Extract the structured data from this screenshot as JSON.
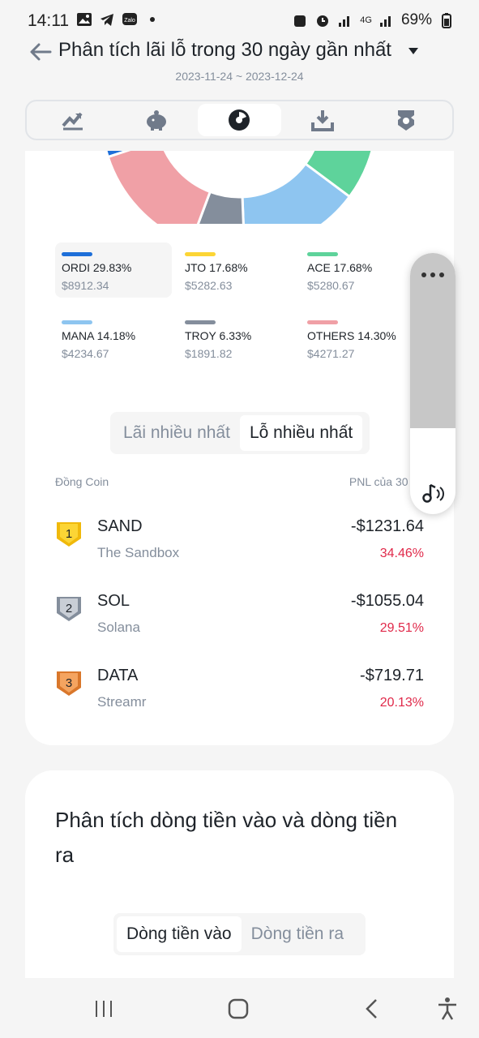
{
  "status_bar": {
    "time": "14:11",
    "battery": "69%",
    "network": "4G"
  },
  "header": {
    "title": "Phân tích lãi lỗ trong 30 ngày gần nhất",
    "date_range": "2023-11-24 ~ 2023-12-24"
  },
  "tabs": [
    {
      "icon": "trend-up-icon",
      "active": false
    },
    {
      "icon": "piggy-bank-icon",
      "active": false
    },
    {
      "icon": "pie-chart-icon",
      "active": true
    },
    {
      "icon": "download-tray-icon",
      "active": false
    },
    {
      "icon": "badge-icon",
      "active": false
    }
  ],
  "chart_data": {
    "type": "pie",
    "categories": [
      "ORDI",
      "JTO",
      "ACE",
      "MANA",
      "TROY",
      "OTHERS"
    ],
    "values": [
      29.83,
      17.68,
      17.68,
      14.18,
      6.33,
      14.3
    ],
    "colors": [
      "#1e6fd9",
      "#fcd535",
      "#5ed39b",
      "#8ec5f0",
      "#848e9c",
      "#f0a0a6"
    ]
  },
  "legend": [
    {
      "label": "ORDI 29.83%",
      "value": "$8912.34",
      "color": "#1e6fd9",
      "selected": true
    },
    {
      "label": "JTO 17.68%",
      "value": "$5282.63",
      "color": "#fcd535",
      "selected": false
    },
    {
      "label": "ACE 17.68%",
      "value": "$5280.67",
      "color": "#5ed39b",
      "selected": false
    },
    {
      "label": "MANA 14.18%",
      "value": "$4234.67",
      "color": "#8ec5f0",
      "selected": false
    },
    {
      "label": "TROY 6.33%",
      "value": "$1891.82",
      "color": "#848e9c",
      "selected": false
    },
    {
      "label": "OTHERS 14.30%",
      "value": "$4271.27",
      "color": "#f0a0a6",
      "selected": false
    }
  ],
  "segment": {
    "option_profit": "Lãi nhiều nhất",
    "option_loss": "Lỗ nhiều nhất",
    "active": "loss"
  },
  "list": {
    "col_coin": "Đồng Coin",
    "col_pnl": "PNL của 30 ng",
    "rows": [
      {
        "rank": "1",
        "symbol": "SAND",
        "name": "The Sandbox",
        "pnl": "-$1231.64",
        "pct": "34.46%"
      },
      {
        "rank": "2",
        "symbol": "SOL",
        "name": "Solana",
        "pnl": "-$1055.04",
        "pct": "29.51%"
      },
      {
        "rank": "3",
        "symbol": "DATA",
        "name": "Streamr",
        "pnl": "-$719.71",
        "pct": "20.13%"
      }
    ]
  },
  "cashflow": {
    "title": "Phân tích dòng tiền vào và dòng tiền ra",
    "option_in": "Dòng tiền vào",
    "option_out": "Dòng tiền ra"
  },
  "floating_widget": {
    "menu_icon": "more-dots-icon",
    "music_icon": "music-note-icon"
  }
}
